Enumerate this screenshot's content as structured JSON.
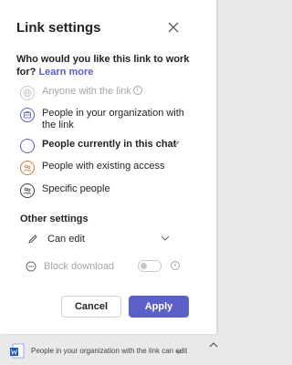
{
  "dialog": {
    "title": "Link settings",
    "question": "Who would you like this link to work for?",
    "learn_more": "Learn more",
    "options": [
      {
        "label": "Anyone with the link",
        "state": "disabled",
        "icon": "globe-icon"
      },
      {
        "label": "People in your organization with the link",
        "state": "enabled",
        "icon": "building-icon"
      },
      {
        "label": "People currently in this chat",
        "state": "selected",
        "icon": "chat-icon"
      },
      {
        "label": "People with existing access",
        "state": "enabled",
        "icon": "people-icon"
      },
      {
        "label": "Specific people",
        "state": "enabled",
        "icon": "people-icon"
      }
    ],
    "other_settings": "Other settings",
    "permission": "Can edit",
    "block_download": "Block download",
    "block_download_on": false,
    "cancel": "Cancel",
    "apply": "Apply"
  },
  "bottom_bar": {
    "text": "People in your organization with the link can edit"
  },
  "colors": {
    "accent": "#5b5fc7",
    "disabled": "#a6a6a6"
  }
}
